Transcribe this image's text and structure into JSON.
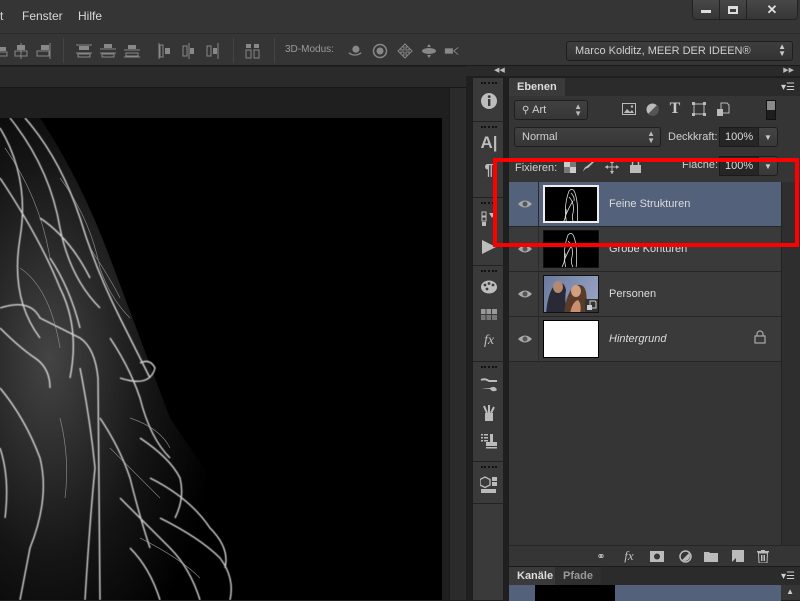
{
  "menubar": {
    "items": [
      "t",
      "Fenster",
      "Hilfe"
    ],
    "window_controls": [
      "minimize",
      "maximize",
      "close"
    ]
  },
  "options_bar": {
    "align_icons": [
      "align-vcenter-icon",
      "align-right-icon",
      "distribute-top-icon",
      "distribute-vcenter-icon",
      "distribute-bottom-icon",
      "distribute-left-icon",
      "distribute-hcenter-icon",
      "distribute-right-icon",
      "auto-align-icon"
    ],
    "mode_label": "3D-Modus:",
    "mode_icons": [
      "rotate-3d-icon",
      "roll-3d-icon",
      "pan-3d-icon",
      "slide-3d-icon",
      "scale-3d-camera-icon"
    ],
    "workspace": "Marco Kolditz, MEER DER IDEEN®"
  },
  "layers_panel": {
    "tab": "Ebenen",
    "filter_kind": "Art",
    "blend_mode": "Normal",
    "opacity_label": "Deckkraft:",
    "opacity_value": "100%",
    "lock_label": "Fixieren:",
    "fill_label": "Fläche:",
    "fill_value": "100%",
    "layers": [
      {
        "name": "Feine Strukturen",
        "visible": true,
        "selected": true,
        "italic": false,
        "locked": false,
        "thumb": "edge-detail"
      },
      {
        "name": "Grobe Konturen",
        "visible": true,
        "selected": false,
        "italic": false,
        "locked": false,
        "thumb": "edge-detail"
      },
      {
        "name": "Personen",
        "visible": true,
        "selected": false,
        "italic": false,
        "locked": false,
        "thumb": "photo",
        "smart_object": true
      },
      {
        "name": "Hintergrund",
        "visible": true,
        "selected": false,
        "italic": true,
        "locked": true,
        "thumb": "white"
      }
    ],
    "footer_icons": [
      "link-layers-icon",
      "fx-icon",
      "add-mask-icon",
      "adjustment-layer-icon",
      "new-group-icon",
      "new-layer-icon",
      "delete-layer-icon"
    ]
  },
  "channels_panel": {
    "tabs": [
      "Kanäle",
      "Pfade"
    ]
  },
  "side_iconbar": {
    "icons": [
      "info-icon",
      "character-icon",
      "paragraph-icon",
      "history-icon",
      "actions-icon",
      "swatches-icon",
      "styles-icon",
      "fx-styles-icon",
      "brush-presets-icon",
      "brushes-icon",
      "clone-source-icon",
      "3d-icon"
    ]
  },
  "annotation": {
    "highlight_color": "#ff0000"
  },
  "colors": {
    "selected_layer": "#53617b",
    "panel_bg": "#353535"
  }
}
